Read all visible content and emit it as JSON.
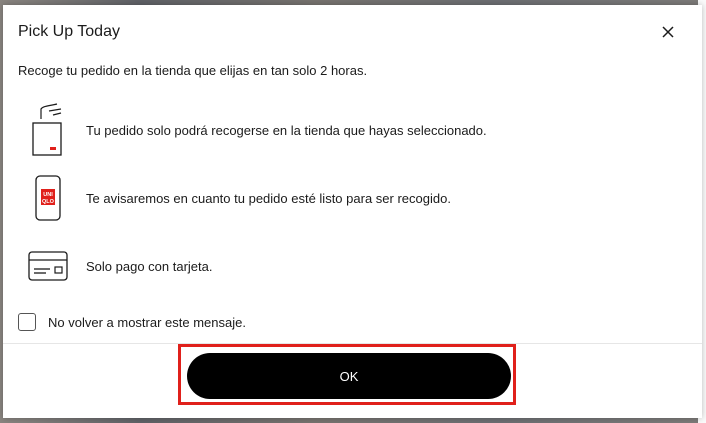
{
  "dialog": {
    "title": "Pick Up Today",
    "intro": "Recoge tu pedido en la tienda que elijas en tan solo 2 horas.",
    "items": [
      {
        "icon": "store-pickup-bag-icon",
        "text": "Tu pedido solo podrá recogerse en la tienda que hayas seleccionado."
      },
      {
        "icon": "phone-uniqlo-icon",
        "text": "Te avisaremos en cuanto tu pedido esté listo para ser recogido."
      },
      {
        "icon": "credit-card-icon",
        "text": "Solo pago con tarjeta."
      }
    ],
    "checkbox_label": "No volver a mostrar este mensaje.",
    "checkbox_checked": false,
    "ok_label": "OK",
    "close_icon": "close-icon"
  },
  "colors": {
    "button_bg": "#000000",
    "button_text": "#ffffff",
    "highlight": "#e0201b",
    "brand_red": "#e0201b"
  },
  "phone_logo": {
    "line1": "UNI",
    "line2": "QLO"
  }
}
